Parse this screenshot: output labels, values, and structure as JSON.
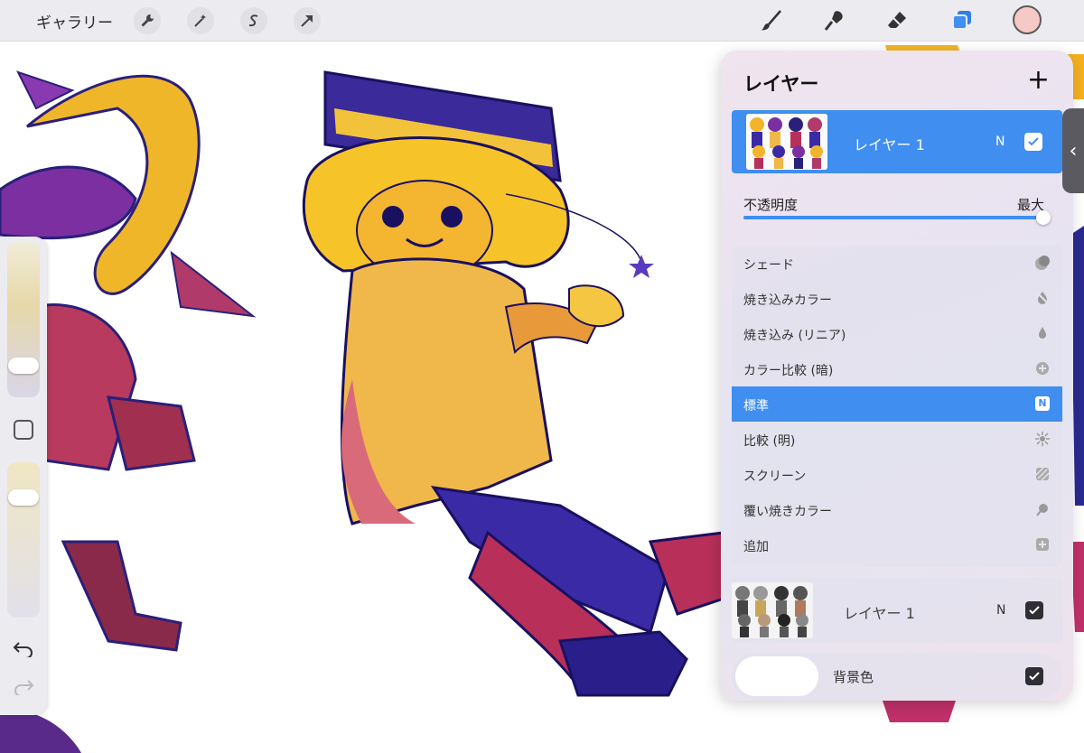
{
  "toolbar": {
    "gallery_label": "ギャラリー",
    "tools_left": [
      "wrench-icon",
      "magic-wand-icon",
      "selection-icon",
      "transform-arrow-icon"
    ],
    "tools_right": [
      "brush-icon",
      "smudge-icon",
      "eraser-icon",
      "layers-icon"
    ],
    "current_color": "#f5c9c6"
  },
  "layers_panel": {
    "title": "レイヤー",
    "add_label": "+",
    "active_layer": {
      "name": "レイヤー 1",
      "mode": "N",
      "visible": true
    },
    "opacity": {
      "label": "不透明度",
      "value_label": "最大",
      "value": 1.0
    },
    "blend_modes": [
      {
        "label": "シェード",
        "icon": "shade-icon"
      },
      {
        "label": "焼き込みカラー",
        "icon": "color-burn-icon"
      },
      {
        "label": "焼き込み (リニア)",
        "icon": "linear-burn-icon"
      },
      {
        "label": "カラー比較 (暗)",
        "icon": "darker-color-icon"
      },
      {
        "label": "標準",
        "icon": "normal-icon",
        "selected": true,
        "badge": "N"
      },
      {
        "label": "比較 (明)",
        "icon": "lighten-icon"
      },
      {
        "label": "スクリーン",
        "icon": "screen-icon"
      },
      {
        "label": "覆い焼きカラー",
        "icon": "color-dodge-icon"
      },
      {
        "label": "追加",
        "icon": "add-icon"
      }
    ],
    "second_layer": {
      "name": "レイヤー 1",
      "mode": "N",
      "visible": true
    },
    "background": {
      "label": "背景色",
      "color": "#ffffff",
      "visible": true
    }
  },
  "colors": {
    "accent": "#3f8ef0",
    "toolbar_bg": "#ecebef"
  }
}
